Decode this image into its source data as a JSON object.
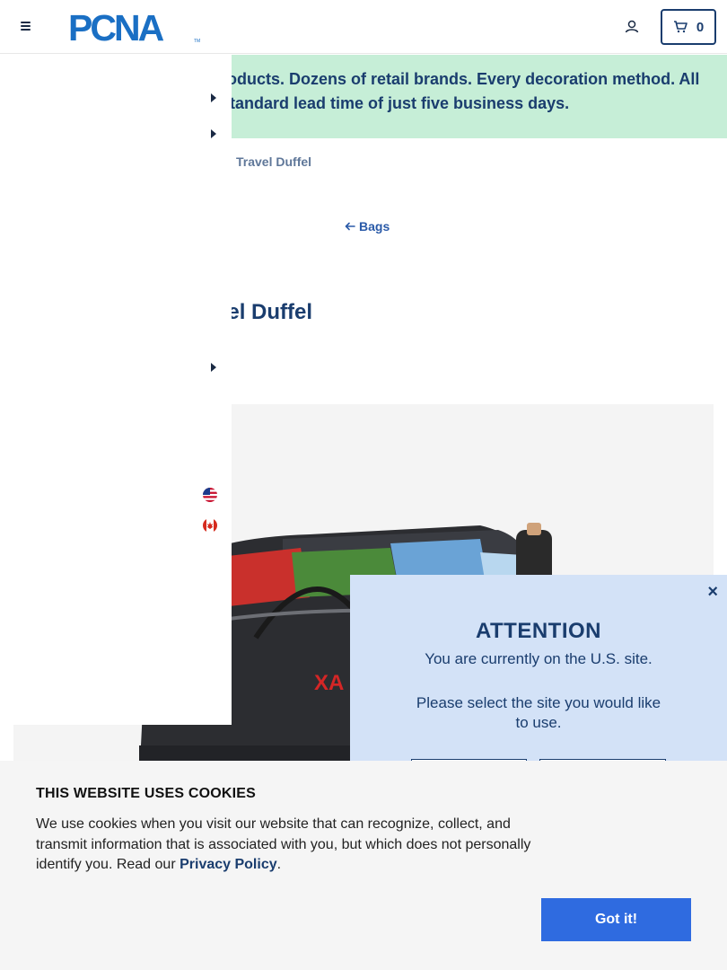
{
  "header": {
    "logo_text": "PCNA",
    "logo_tm": "TM",
    "cart_count": "0"
  },
  "promo": {
    "text": "roducts. Dozens of retail brands. Every decoration method. All standard lead time of just five business days."
  },
  "breadcrumb": {
    "current": "Travel Duffel"
  },
  "back_link": {
    "label": "Bags"
  },
  "product": {
    "title_visible": "vel Duffel",
    "imprint_text": "XA"
  },
  "attention_modal": {
    "close_label": "×",
    "title": "ATTENTION",
    "message": "You are currently on the U.S. site.",
    "prompt": "Please select the site you would like to use."
  },
  "cookie_banner": {
    "title": "THIS WEBSITE USES COOKIES",
    "text_before_link": "We use cookies when you visit our website that can recognize, collect, and transmit information that is associated with you, but which does not personally identify you. Read our ",
    "link_label": "Privacy Policy",
    "text_after_link": ".",
    "accept_label": "Got it!"
  },
  "colors": {
    "brand_navy": "#1a3d6e",
    "promo_bg": "#c6eed7",
    "modal_bg": "#d3e2f7",
    "accept_button": "#2f6be0"
  },
  "icons": [
    "hamburger-icon",
    "account-icon",
    "cart-icon",
    "caret-right-icon",
    "arrow-left-icon",
    "us-flag-icon",
    "canada-flag-icon"
  ]
}
